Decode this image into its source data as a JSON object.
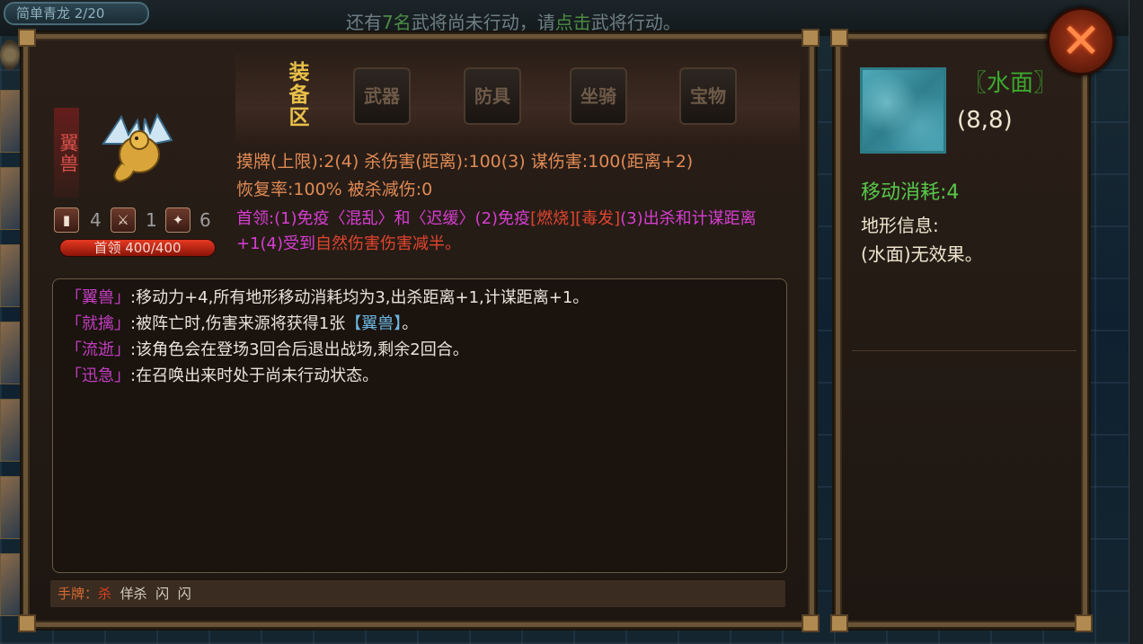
{
  "header": {
    "stage": "简单青龙 2/20",
    "notice_before": "还有",
    "notice_count": "7名",
    "notice_mid": "武将尚未行动，请",
    "notice_click": "点击",
    "notice_after": "武将行动。"
  },
  "unit": {
    "name": "翼兽",
    "stats": [
      {
        "icon": "card-icon",
        "value": "4"
      },
      {
        "icon": "sword-icon",
        "value": "1"
      },
      {
        "icon": "skill-icon",
        "value": "6"
      }
    ],
    "hp_label": "首领 400/400",
    "hp_fraction": 1.0
  },
  "equipment": {
    "title": "装备区",
    "slots": [
      "武器",
      "防具",
      "坐骑",
      "宝物"
    ]
  },
  "attributes": {
    "line1": "摸牌(上限):2(4)    杀伤害(距离):100(3)    谋伤害:100(距离+2)",
    "line2": "恢复率:100%    被杀减伤:0"
  },
  "ability": {
    "part1": "首领:(1)免疫〈混乱〉和〈迟缓〉(2)免疫",
    "burn": "[燃烧][毒发]",
    "part2": "(3)出杀和计谋距离+1(4)受到",
    "natural": "自然伤害伤害减半。"
  },
  "skills": [
    {
      "name": "「翼兽」",
      "text": ":移动力+4,所有地形移动消耗均为3,出杀距离+1,计谋距离+1。"
    },
    {
      "name": "「就擒」",
      "text": ":被阵亡时,伤害来源将获得1张",
      "highlight": "【翼兽】",
      "tail": "。"
    },
    {
      "name": "「流逝」",
      "text": ":该角色会在登场3回合后退出战场,剩余2回合。"
    },
    {
      "name": "「迅急」",
      "text": ":在召唤出来时处于尚未行动状态。"
    }
  ],
  "hand": {
    "label": "手牌：",
    "cards": [
      "杀",
      "佯杀",
      "闪",
      "闪"
    ]
  },
  "terrain": {
    "name": "〖水面〗",
    "coord": "(8,8)",
    "move_cost": "移动消耗:4",
    "info_label": "地形信息:",
    "info_text": "(水面)无效果。"
  },
  "close": {
    "label": "✕"
  }
}
